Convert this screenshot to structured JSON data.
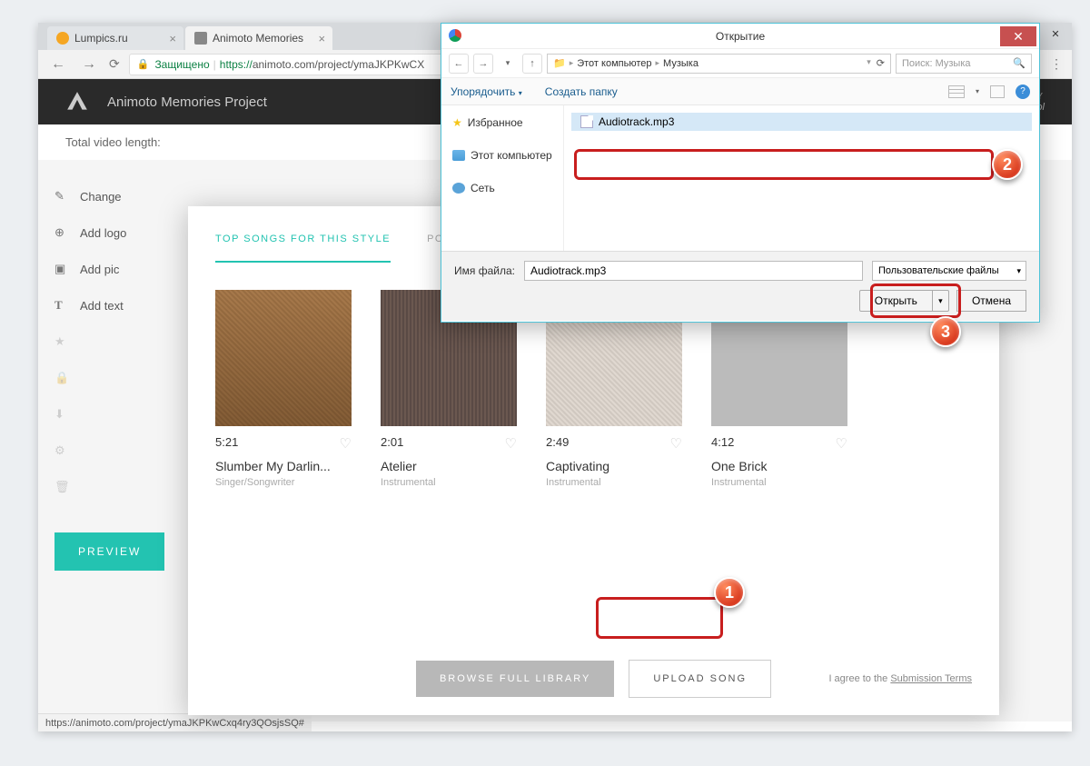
{
  "browser": {
    "tabs": [
      {
        "title": "Lumpics.ru",
        "favicon": "#f5a623"
      },
      {
        "title": "Animoto Memories",
        "favicon": "#888888"
      }
    ],
    "secure_label": "Защищено",
    "url_prefix": "https://",
    "url": "animoto.com/project/ymaJKPKwCX",
    "status_bar": "https://animoto.com/project/ymaJKPKwCxq4ry3QOsjsSQ#"
  },
  "page": {
    "project_title": "Animoto Memories Project",
    "style_label": "STY",
    "style_sub": "Accol",
    "total_label": "Total video length:",
    "sidebar": [
      {
        "label": "Change",
        "icon": "✎"
      },
      {
        "label": "Add logo",
        "icon": "⏱"
      },
      {
        "label": "Add pic",
        "icon": "🖼"
      },
      {
        "label": "Add text",
        "icon": "T"
      },
      {
        "label": "",
        "icon": "★"
      },
      {
        "label": "",
        "icon": "🔒"
      },
      {
        "label": "",
        "icon": "⬇"
      },
      {
        "label": "",
        "icon": "⚙"
      },
      {
        "label": "",
        "icon": "🗑"
      }
    ],
    "preview_button": "PREVIEW"
  },
  "modal": {
    "tabs": [
      "TOP SONGS FOR THIS STYLE",
      "POPULAR FOR P"
    ],
    "songs": [
      {
        "duration": "5:21",
        "title": "Slumber My Darlin...",
        "sub": "Singer/Songwriter"
      },
      {
        "duration": "2:01",
        "title": "Atelier",
        "sub": "Instrumental"
      },
      {
        "duration": "2:49",
        "title": "Captivating",
        "sub": "Instrumental"
      },
      {
        "duration": "4:12",
        "title": "One Brick",
        "sub": "Instrumental"
      }
    ],
    "browse_label": "BROWSE FULL LIBRARY",
    "upload_label": "UPLOAD SONG",
    "terms_prefix": "I agree to the ",
    "terms_link": "Submission Terms"
  },
  "file_dialog": {
    "title": "Открытие",
    "path": [
      "Этот компьютер",
      "Музыка"
    ],
    "search_placeholder": "Поиск: Музыка",
    "toolbar": {
      "organize": "Упорядочить",
      "new_folder": "Создать папку"
    },
    "sidebar": [
      {
        "label": "Избранное",
        "type": "star"
      },
      {
        "label": "Этот компьютер",
        "type": "pc"
      },
      {
        "label": "Сеть",
        "type": "net"
      }
    ],
    "files": [
      {
        "name": "Audiotrack.mp3"
      }
    ],
    "filename_label": "Имя файла:",
    "filename_value": "Audiotrack.mp3",
    "filter_label": "Пользовательские файлы",
    "open_btn": "Открыть",
    "cancel_btn": "Отмена"
  },
  "annotations": {
    "b1": "1",
    "b2": "2",
    "b3": "3"
  }
}
